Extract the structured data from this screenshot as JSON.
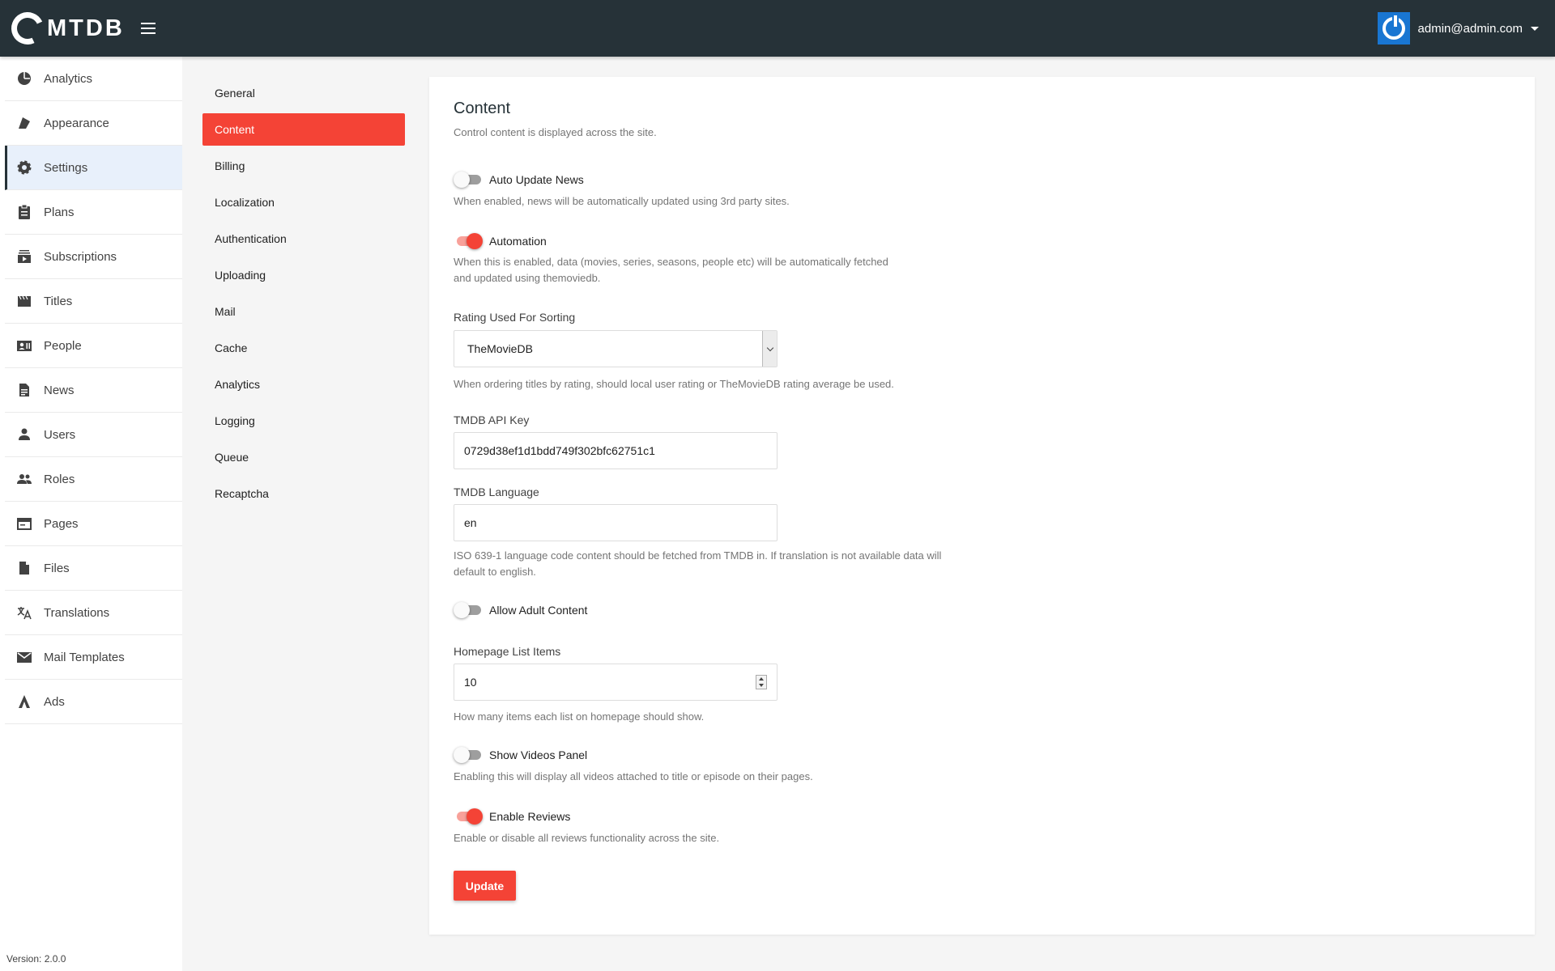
{
  "app": {
    "logo_text": "MTDB",
    "version": "Version: 2.0.0"
  },
  "account": {
    "email": "admin@admin.com"
  },
  "sidebar": {
    "items": [
      {
        "label": "Analytics",
        "icon": "pie-chart-icon"
      },
      {
        "label": "Appearance",
        "icon": "palette-icon"
      },
      {
        "label": "Settings",
        "icon": "gear-icon",
        "active": true
      },
      {
        "label": "Plans",
        "icon": "clipboard-icon"
      },
      {
        "label": "Subscriptions",
        "icon": "subscriptions-icon"
      },
      {
        "label": "Titles",
        "icon": "movie-icon"
      },
      {
        "label": "People",
        "icon": "people-card-icon"
      },
      {
        "label": "News",
        "icon": "document-icon"
      },
      {
        "label": "Users",
        "icon": "person-icon"
      },
      {
        "label": "Roles",
        "icon": "group-icon"
      },
      {
        "label": "Pages",
        "icon": "pages-icon"
      },
      {
        "label": "Files",
        "icon": "file-icon"
      },
      {
        "label": "Translations",
        "icon": "translate-icon"
      },
      {
        "label": "Mail Templates",
        "icon": "mail-icon"
      },
      {
        "label": "Ads",
        "icon": "ads-icon"
      }
    ]
  },
  "submenu": {
    "items": [
      "General",
      "Content",
      "Billing",
      "Localization",
      "Authentication",
      "Uploading",
      "Mail",
      "Cache",
      "Analytics",
      "Logging",
      "Queue",
      "Recaptcha"
    ],
    "active": "Content"
  },
  "content": {
    "title": "Content",
    "subtitle": "Control content is displayed across the site.",
    "auto_update_news": {
      "label": "Auto Update News",
      "enabled": false,
      "description": "When enabled, news will be automatically updated using 3rd party sites."
    },
    "automation": {
      "label": "Automation",
      "enabled": true,
      "description_line1": "When this is enabled, data (movies, series, seasons, people etc) will be automatically fetched",
      "description_line2": "and updated using themoviedb."
    },
    "rating_sorting": {
      "label": "Rating Used For Sorting",
      "value": "TheMovieDB",
      "description": "When ordering titles by rating, should local user rating or TheMovieDB rating average be used."
    },
    "tmdb_api_key": {
      "label": "TMDB API Key",
      "value": "0729d38ef1d1bdd749f302bfc62751c1"
    },
    "tmdb_language": {
      "label": "TMDB Language",
      "value": "en",
      "description_line1": "ISO 639-1 language code content should be fetched from TMDB in. If translation is not available data will",
      "description_line2": "default to english."
    },
    "allow_adult": {
      "label": "Allow Adult Content",
      "enabled": false
    },
    "homepage_list_items": {
      "label": "Homepage List Items",
      "value": "10",
      "description": "How many items each list on homepage should show."
    },
    "show_videos_panel": {
      "label": "Show Videos Panel",
      "enabled": false,
      "description": "Enabling this will display all videos attached to title or episode on their pages."
    },
    "enable_reviews": {
      "label": "Enable Reviews",
      "enabled": true,
      "description": "Enable or disable all reviews functionality across the site."
    },
    "update_button": "Update"
  },
  "colors": {
    "accent": "#f44336",
    "topbar": "#263238",
    "avatar": "#1976d2"
  }
}
